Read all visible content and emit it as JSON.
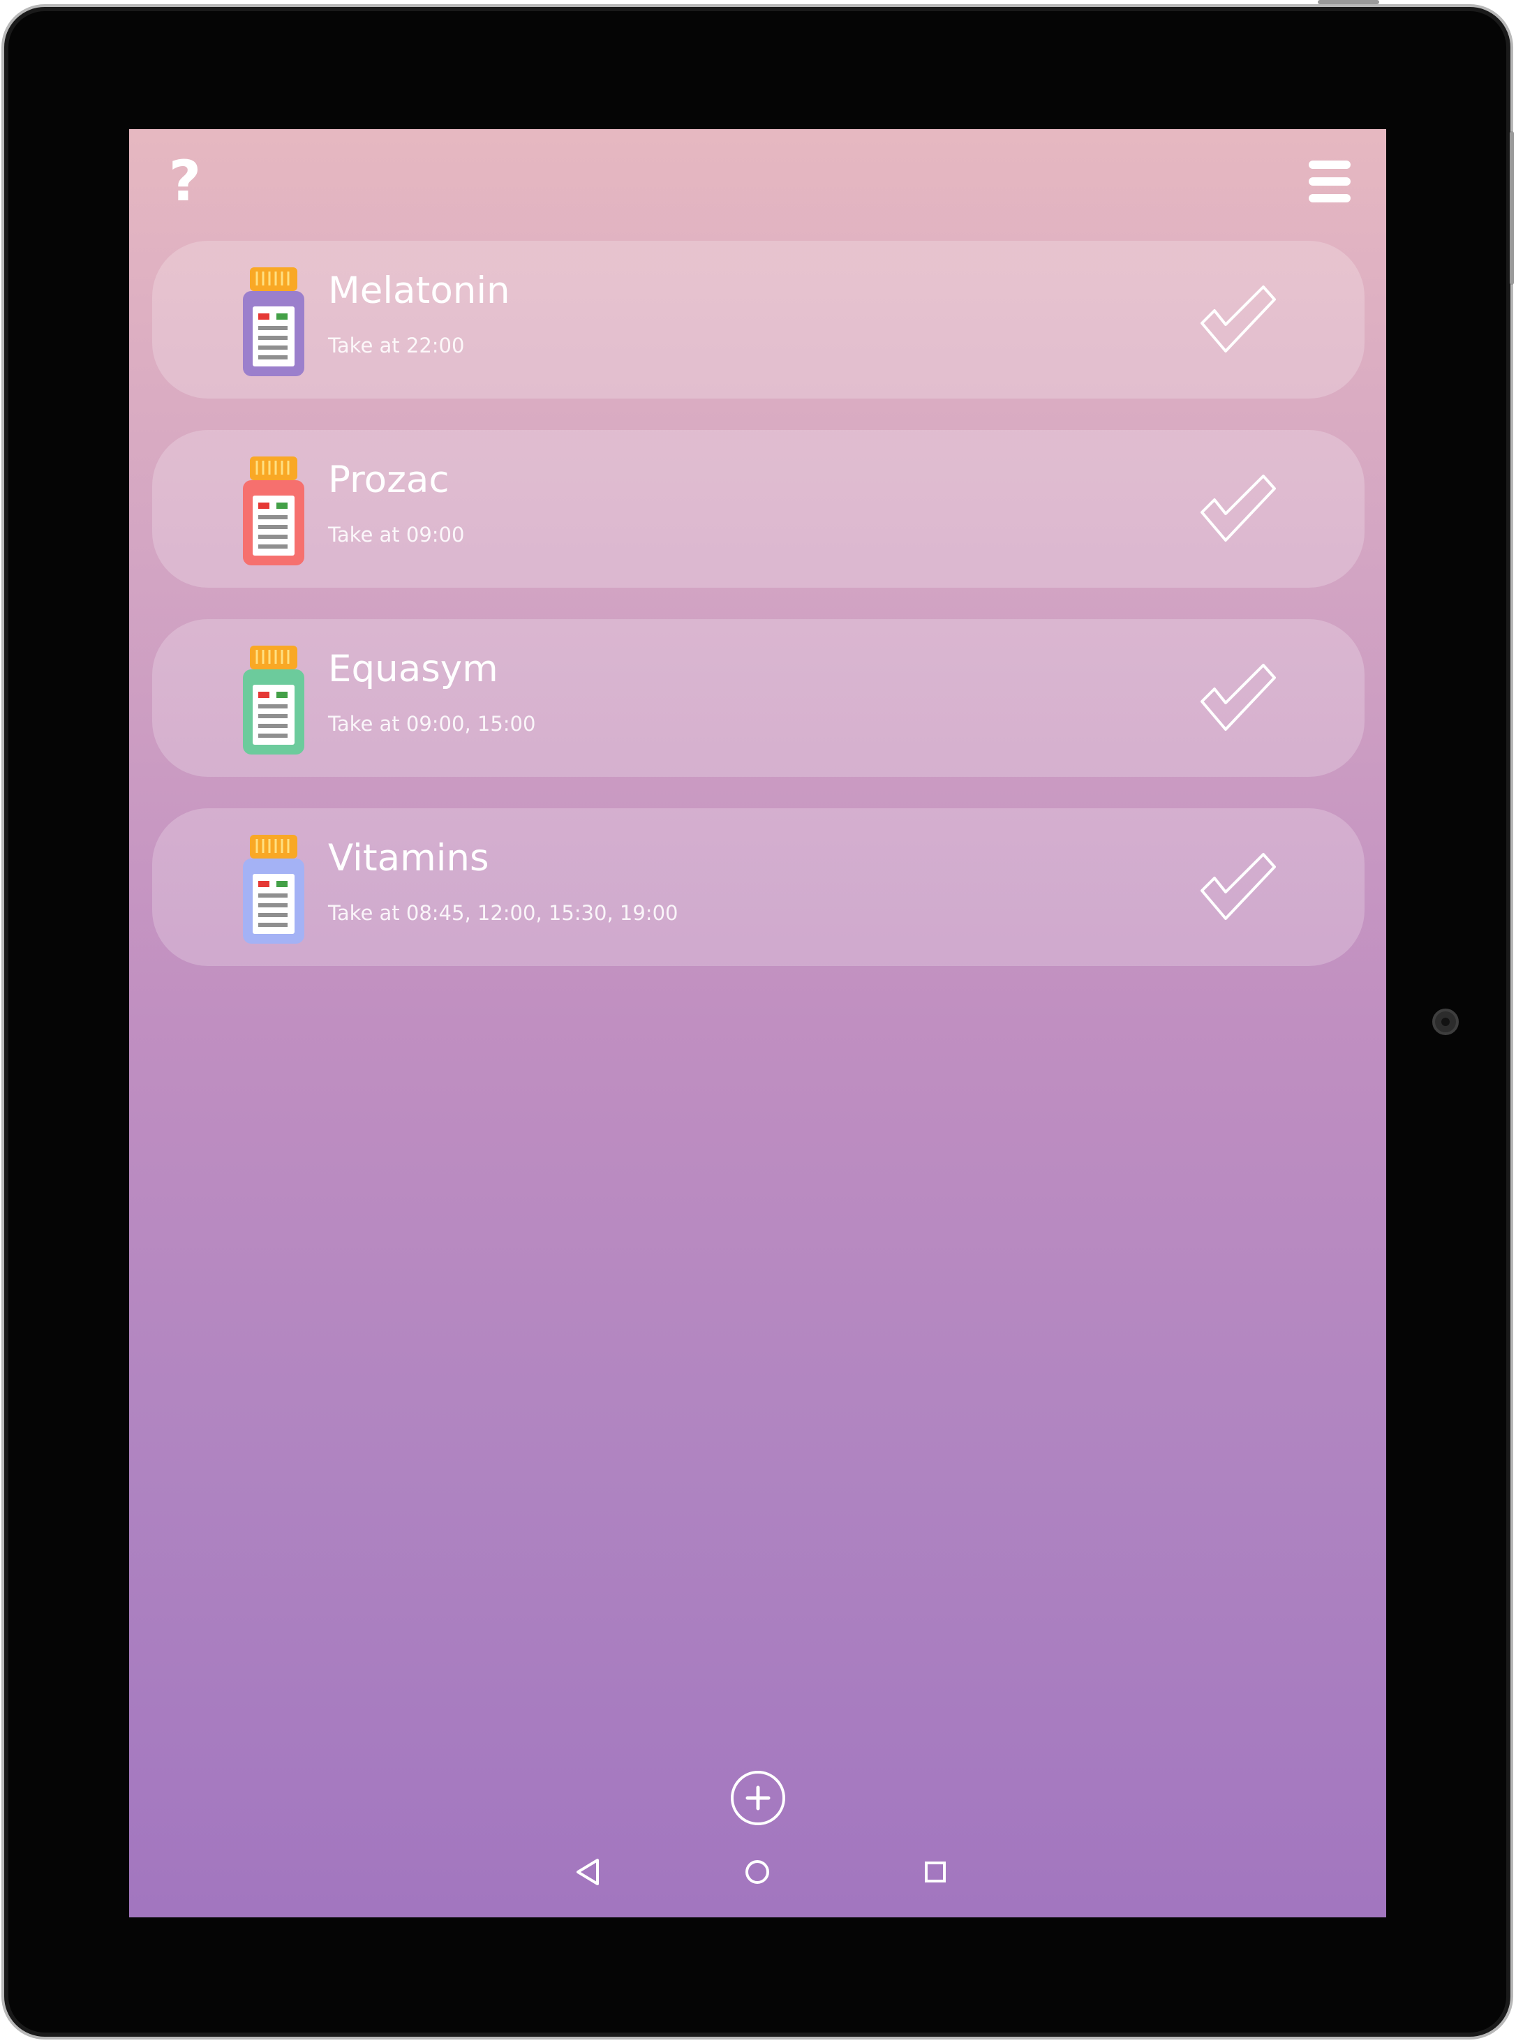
{
  "header": {
    "help_label": "?",
    "help_icon": "help-icon",
    "menu_icon": "hamburger-menu-icon"
  },
  "medications": [
    {
      "name": "Melatonin",
      "schedule": "Take at 22:00",
      "bottle_color": "#9b7fcc",
      "status_icon": "checkmark-icon"
    },
    {
      "name": "Prozac",
      "schedule": "Take at 09:00",
      "bottle_color": "#f6706e",
      "status_icon": "checkmark-icon"
    },
    {
      "name": "Equasym",
      "schedule": "Take at 09:00, 15:00",
      "bottle_color": "#6ccb9c",
      "status_icon": "checkmark-icon"
    },
    {
      "name": "Vitamins",
      "schedule": "Take at 08:45, 12:00, 15:30, 19:00",
      "bottle_color": "#a4b2f5",
      "status_icon": "checkmark-icon"
    }
  ],
  "actions": {
    "add_icon": "plus-circle-icon"
  },
  "colors": {
    "gradient_top": "#e6b8c1",
    "gradient_bottom": "#a276bf",
    "bottle_cap": "#f9a825",
    "label_red": "#e53935",
    "label_green": "#43a047"
  },
  "system_nav": {
    "back_icon": "back-triangle-icon",
    "home_icon": "home-circle-icon",
    "recents_icon": "recents-square-icon"
  }
}
